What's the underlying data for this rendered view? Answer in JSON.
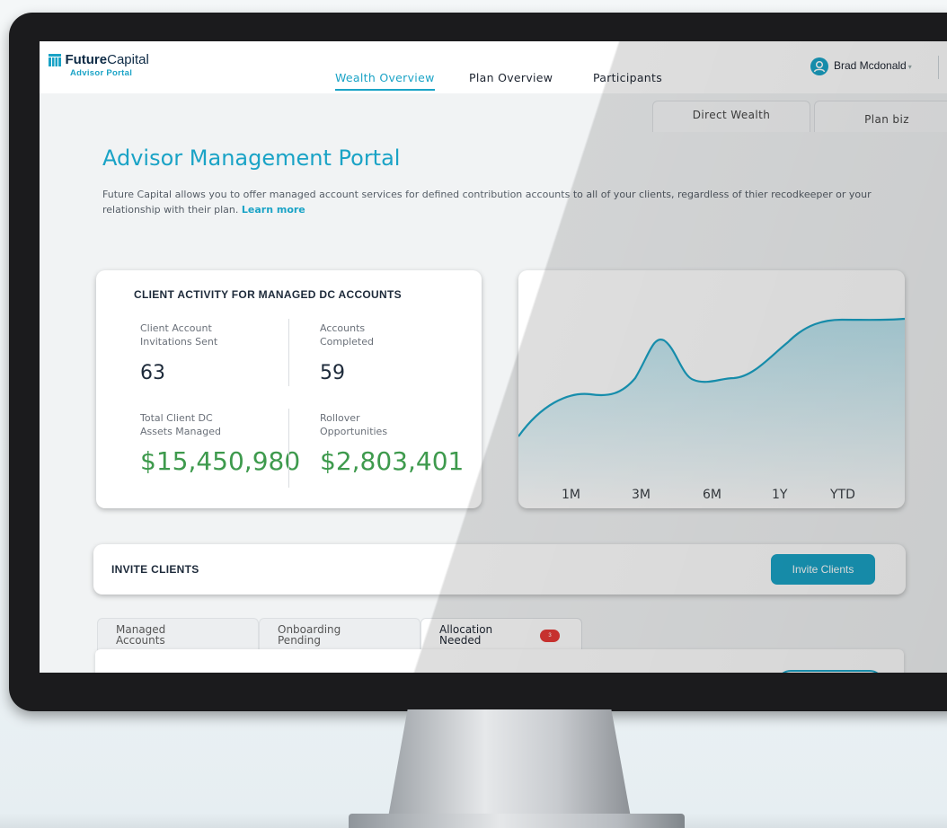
{
  "header": {
    "brand_bold": "Future",
    "brand_rest": "Capital",
    "brand_sub": "Advisor Portal",
    "nav": [
      {
        "label": "Wealth Overview",
        "active": true
      },
      {
        "label": "Plan Overview",
        "active": false
      },
      {
        "label": "Participants",
        "active": false
      }
    ],
    "user_name": "Brad Mcdonald"
  },
  "top_tabs": [
    {
      "label": "Direct Wealth"
    },
    {
      "label": "Plan biz"
    }
  ],
  "page": {
    "title": "Advisor Management Portal",
    "description": "Future Capital allows you to offer managed account services for defined contribution accounts to all of your clients, regardless of thier recodkeeper or your relationship with their plan.",
    "learn_more": "Learn more"
  },
  "activity": {
    "title": "CLIENT ACTIVITY FOR MANAGED DC ACCOUNTS",
    "stats": [
      {
        "label_1": "Client Account",
        "label_2": "Invitations Sent",
        "value": "63"
      },
      {
        "label_1": "Accounts",
        "label_2": "Completed",
        "value": "59"
      },
      {
        "label_1": "Total Client DC",
        "label_2": "Assets Managed",
        "value": "$15,450,980"
      },
      {
        "label_1": "Rollover",
        "label_2": "Opportunities",
        "value": "$2,803,401"
      }
    ]
  },
  "trend_chart": {
    "ranges": [
      "1M",
      "3M",
      "6M",
      "1Y",
      "YTD"
    ]
  },
  "invite": {
    "label": "INVITE CLIENTS",
    "button_label": "Invite Clients"
  },
  "bottom_tabs": [
    {
      "line1": "Managed",
      "line2": "Accounts",
      "active": false
    },
    {
      "line1": "Onboarding",
      "line2": "Pending",
      "active": false
    },
    {
      "line1": "Allocation",
      "line2": "Needed",
      "active": true,
      "badge": "3"
    }
  ],
  "colors": {
    "accent": "#1aa3c6",
    "money": "#3e9a4d",
    "badge": "#e53935",
    "monitor_bezel": "#1b1b1d"
  }
}
